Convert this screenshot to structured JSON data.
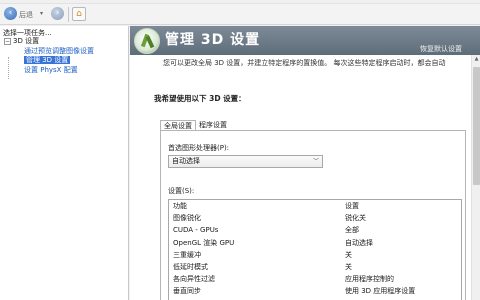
{
  "toolbar": {
    "back_label": "后退",
    "back_dropdown": "▾"
  },
  "left_panel": {
    "title": "选择一项任务...",
    "tree": [
      {
        "label": "3D 设置",
        "level": 0
      },
      {
        "label": "通过预览调整图像设置",
        "level": 1
      },
      {
        "label": "管理 3D 设置",
        "level": 1,
        "selected": true
      },
      {
        "label": "设置 PhysX 配置",
        "level": 1
      }
    ],
    "toggle_symbol": "−"
  },
  "banner": {
    "title": "管理 3D 设置",
    "restore_defaults": "恢复默认设置"
  },
  "description": "您可以更改全局 3D 设置，并建立特定程序的置换值。 每次这些特定程序启动时，都会自动",
  "prompt": "我希望使用以下 3D 设置：",
  "tabs": [
    {
      "label": "全局设置",
      "active": true
    },
    {
      "label": "程序设置",
      "active": false
    }
  ],
  "gpu": {
    "label": "首选图形处理器(P):",
    "selected": "自动选择"
  },
  "settings": {
    "label": "设置(S):",
    "header": {
      "feature": "功能",
      "value": "设置"
    },
    "rows": [
      {
        "feature": "图像锐化",
        "value": "锐化关"
      },
      {
        "feature": "CUDA - GPUs",
        "value": "全部"
      },
      {
        "feature": "OpenGL 渲染 GPU",
        "value": "自动选择"
      },
      {
        "feature": "三重缓冲",
        "value": "关"
      },
      {
        "feature": "低延时模式",
        "value": "关"
      },
      {
        "feature": "各向异性过滤",
        "value": "应用程序控制的"
      },
      {
        "feature": "垂直同步",
        "value": "使用 3D 应用程序设置"
      }
    ]
  },
  "icons": {
    "back": "back-arrow-icon",
    "forward": "forward-arrow-icon",
    "home": "home-icon",
    "nvidia": "nvidia-3d-settings-icon"
  },
  "colors": {
    "banner": "#6e7c89",
    "link": "#1a5fc4",
    "selection": "#3874d8"
  }
}
